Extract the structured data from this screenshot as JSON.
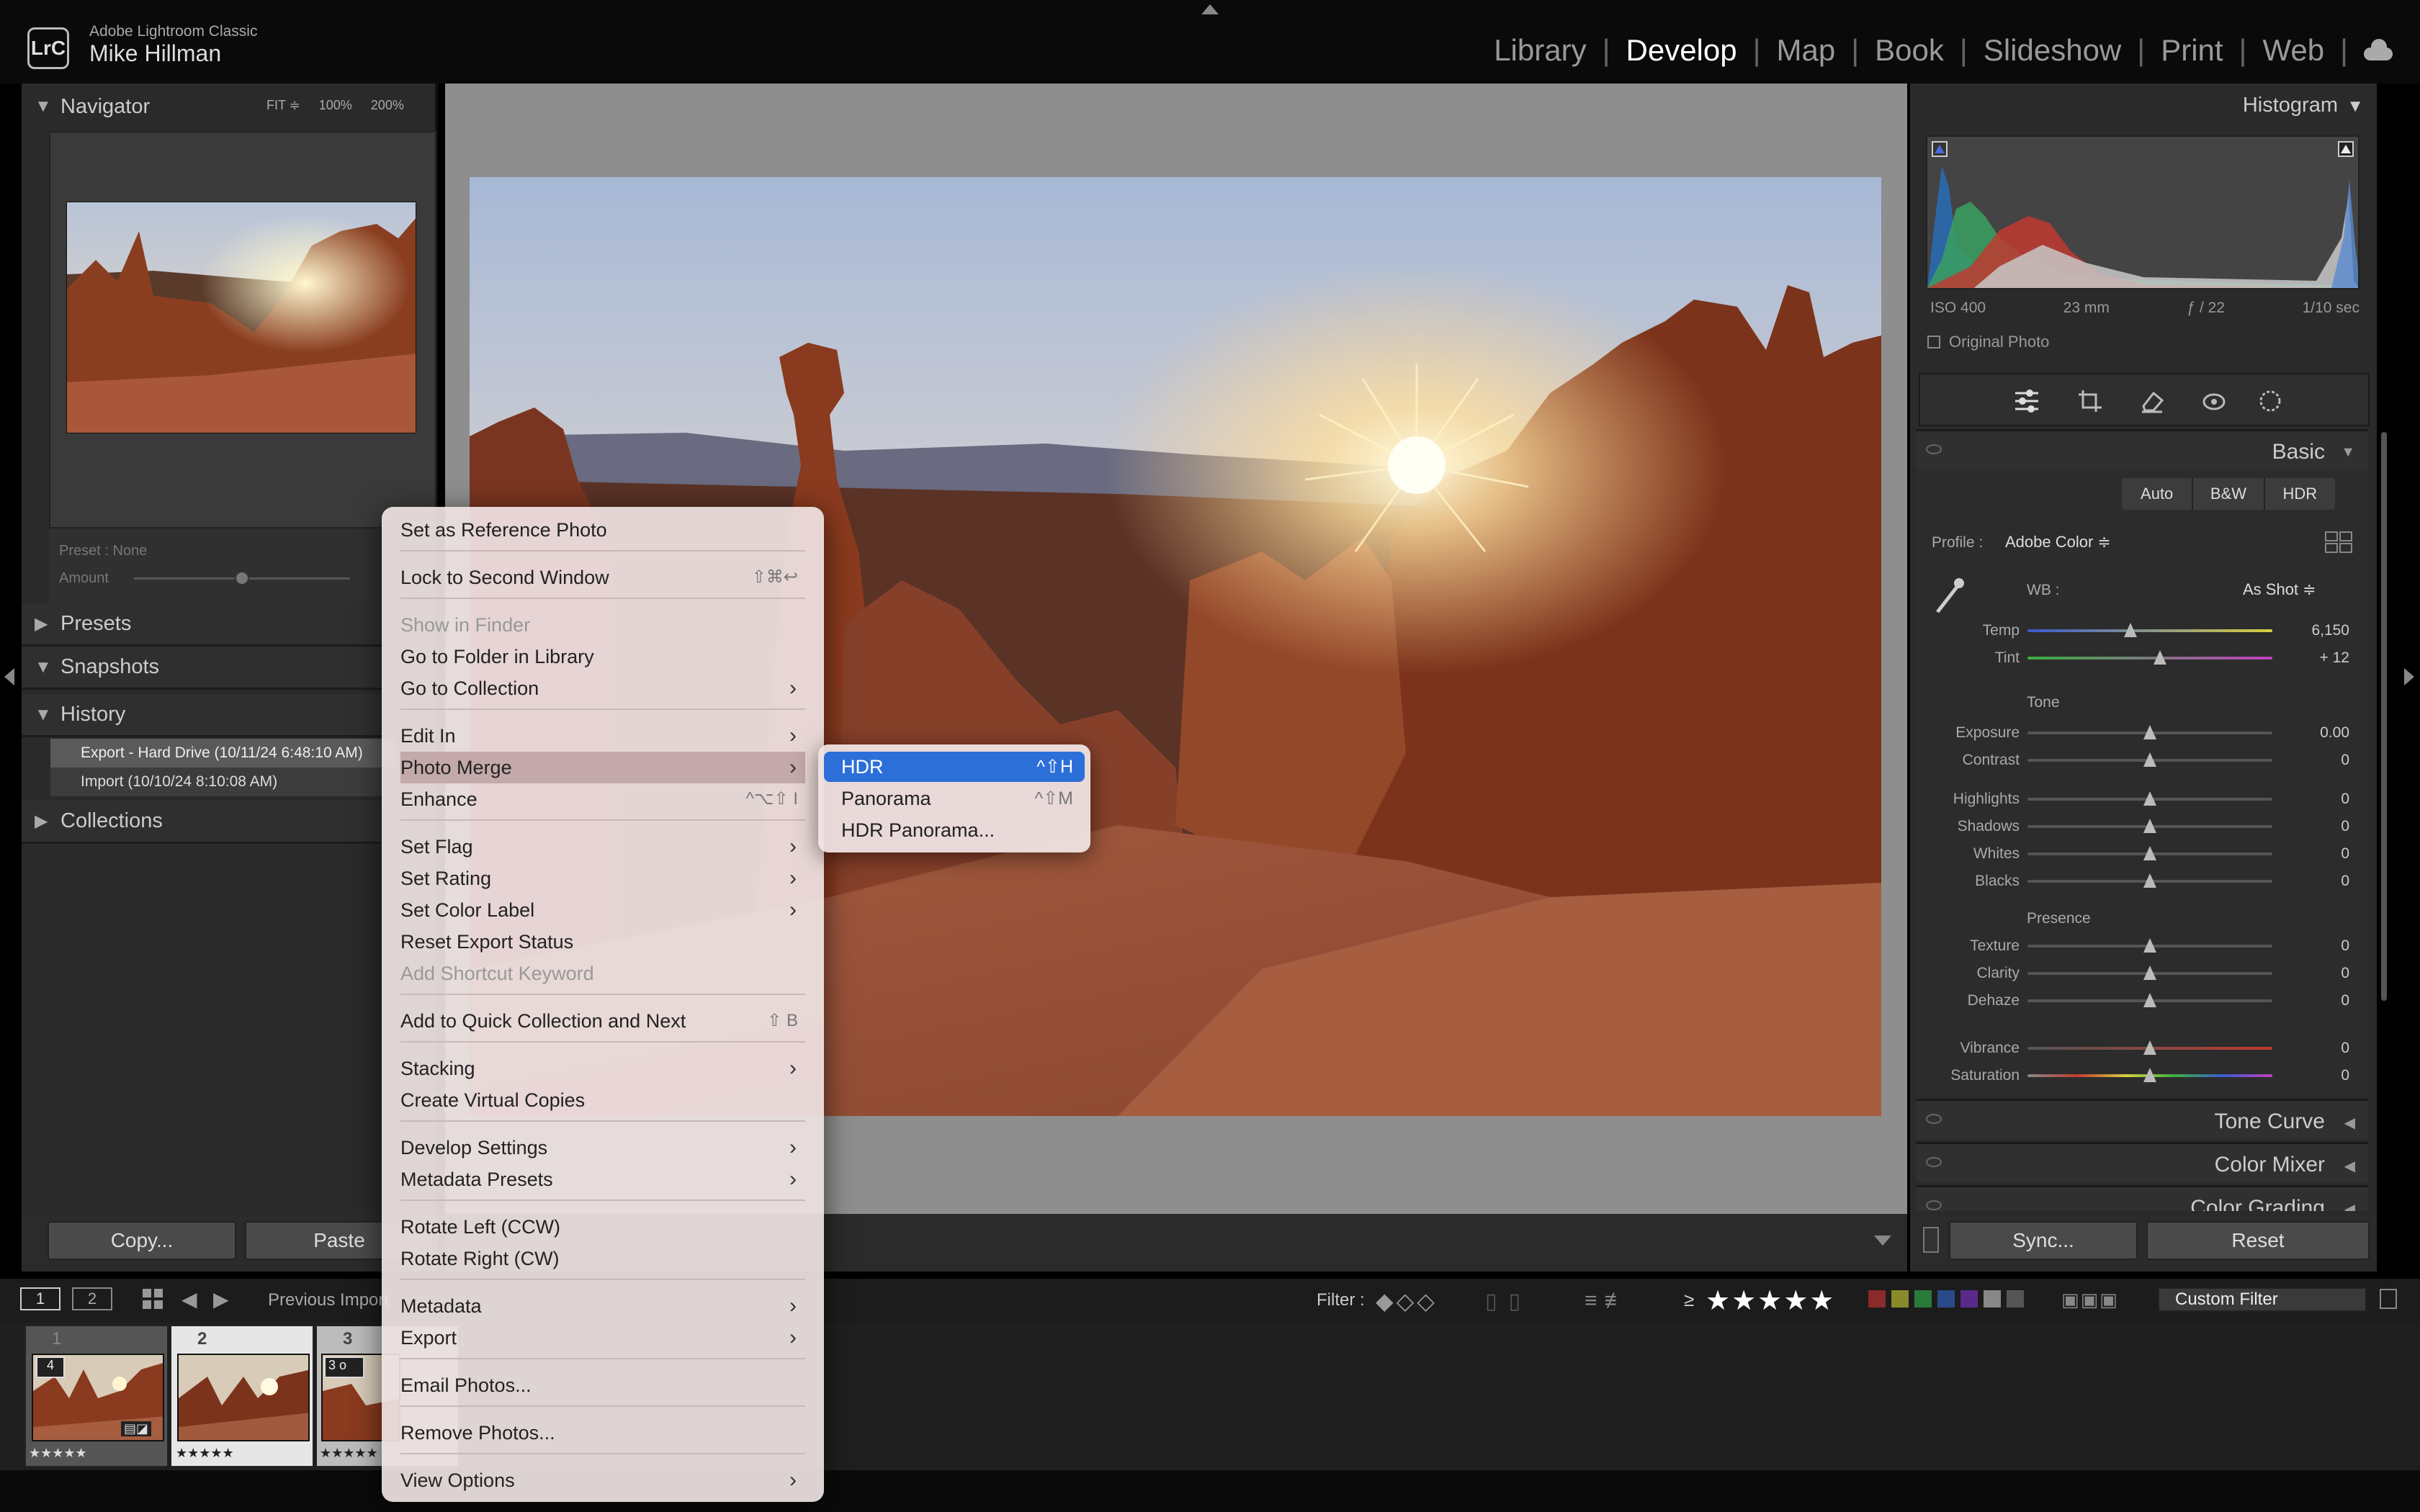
{
  "app": {
    "logo": "LrC",
    "name": "Adobe Lightroom Classic",
    "user": "Mike Hillman"
  },
  "modules": [
    "Library",
    "Develop",
    "Map",
    "Book",
    "Slideshow",
    "Print",
    "Web"
  ],
  "active_module": "Develop",
  "left": {
    "navigator": {
      "title": "Navigator",
      "fit": "FIT ≑",
      "z1": "100%",
      "z2": "200%"
    },
    "preset": {
      "label": "Preset : None",
      "amount": "Amount",
      "amount_value": 0.5
    },
    "panels": {
      "presets": "Presets",
      "snapshots": "Snapshots",
      "history": "History",
      "collections": "Collections"
    },
    "history_items": [
      "Export - Hard Drive (10/11/24 6:48:10 AM)",
      "Import (10/10/24 8:10:08 AM)"
    ],
    "copy_button": "Copy...",
    "paste_button": "Paste"
  },
  "right": {
    "histogram_title": "Histogram",
    "exif": {
      "iso": "ISO 400",
      "focal": "23 mm",
      "aperture": "ƒ / 22",
      "shutter": "1/10 sec"
    },
    "original_photo": "Original Photo",
    "basic_title": "Basic",
    "auto": "Auto",
    "bw": "B&W",
    "hdr": "HDR",
    "profile_label": "Profile :",
    "profile_value": "Adobe Color ≑",
    "wb_label": "WB :",
    "wb_value": "As Shot ≑",
    "tone_label": "Tone",
    "presence_label": "Presence",
    "sliders": [
      {
        "label": "Temp",
        "value": "6,150",
        "pos": 0.42
      },
      {
        "label": "Tint",
        "value": "+ 12",
        "pos": 0.54
      },
      {
        "label": "Exposure",
        "value": "0.00",
        "pos": 0.5
      },
      {
        "label": "Contrast",
        "value": "0",
        "pos": 0.5
      },
      {
        "label": "Highlights",
        "value": "0",
        "pos": 0.5
      },
      {
        "label": "Shadows",
        "value": "0",
        "pos": 0.5
      },
      {
        "label": "Whites",
        "value": "0",
        "pos": 0.5
      },
      {
        "label": "Blacks",
        "value": "0",
        "pos": 0.5
      },
      {
        "label": "Texture",
        "value": "0",
        "pos": 0.5
      },
      {
        "label": "Clarity",
        "value": "0",
        "pos": 0.5
      },
      {
        "label": "Dehaze",
        "value": "0",
        "pos": 0.5
      },
      {
        "label": "Vibrance",
        "value": "0",
        "pos": 0.5
      },
      {
        "label": "Saturation",
        "value": "0",
        "pos": 0.5
      }
    ],
    "tone_curve": "Tone Curve",
    "color_mixer": "Color Mixer",
    "color_grading": "Color Grading",
    "sync_button": "Sync...",
    "reset_button": "Reset"
  },
  "filmstrip": {
    "view1": "1",
    "view2": "2",
    "source": "Previous Import",
    "filter_label": "Filter :",
    "rating_prefix": "≥",
    "stars": "★★★★★",
    "custom_filter": "Custom Filter",
    "cells": [
      {
        "num": "1",
        "badge": "4",
        "stars": "★★★★★"
      },
      {
        "num": "2",
        "badge": "",
        "stars": "★★★★★"
      },
      {
        "num": "3",
        "badge": "3 o",
        "stars": "★★★★★"
      }
    ]
  },
  "context_menu": {
    "items": [
      "Set as Reference Photo",
      "Lock to Second Window",
      "Show in Finder",
      "Go to Folder in Library",
      "Go to Collection",
      "Edit In",
      "Photo Merge",
      "Enhance",
      "Set Flag",
      "Set Rating",
      "Set Color Label",
      "Reset Export Status",
      "Add Shortcut Keyword",
      "Add to Quick Collection and Next",
      "Stacking",
      "Create Virtual Copies",
      "Develop Settings",
      "Metadata Presets",
      "Rotate Left (CCW)",
      "Rotate Right (CW)",
      "Metadata",
      "Export",
      "Email Photos...",
      "Remove Photos...",
      "View Options"
    ],
    "shortcuts": {
      "lock": "⇧⌘↩",
      "enhance": "^⌥⇧ I",
      "quick": "⇧ B"
    }
  },
  "submenu": {
    "items": [
      "HDR",
      "Panorama",
      "HDR Panorama..."
    ],
    "shortcuts": [
      "^⇧H",
      "^⇧M",
      ""
    ]
  },
  "colors": {
    "accent": "#2c6fd9",
    "bg": "#2a2a2a",
    "menu": "#eee2e2"
  }
}
